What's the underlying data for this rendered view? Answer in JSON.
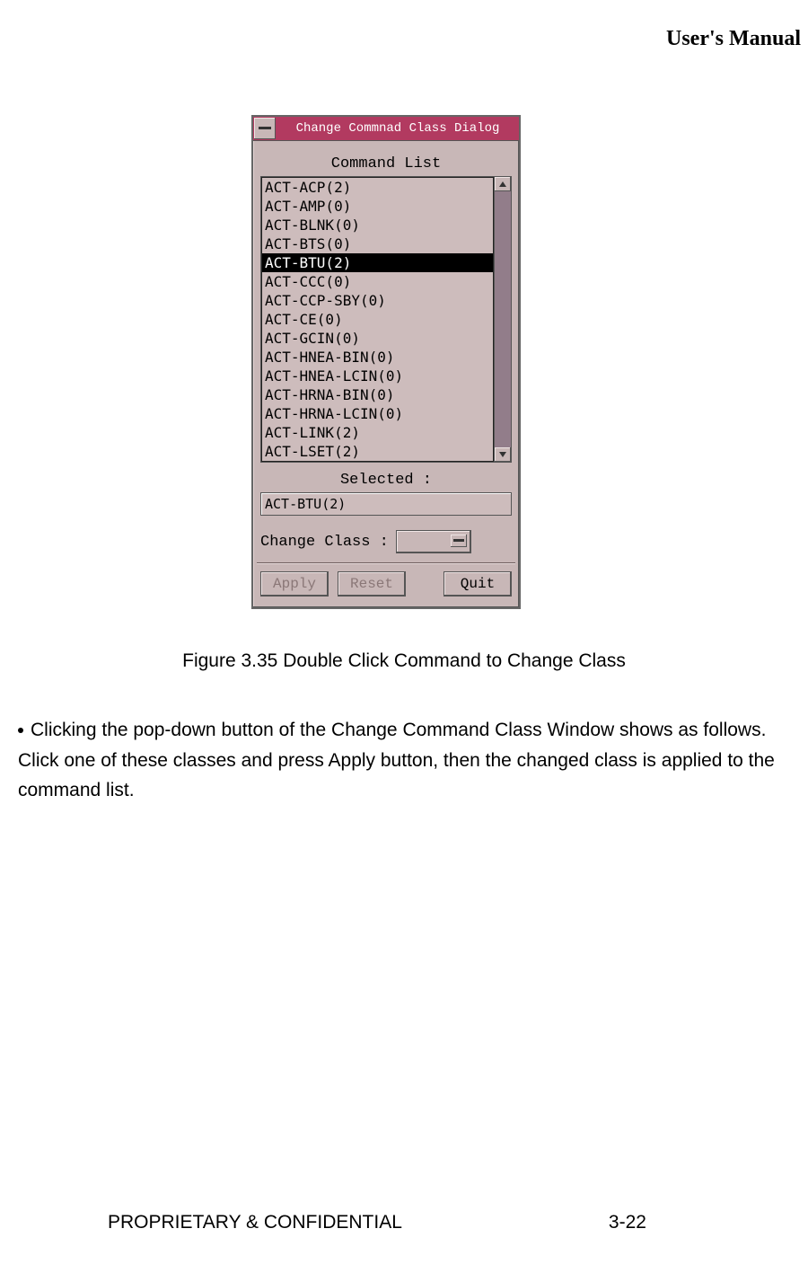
{
  "header": {
    "running": "User's Manual"
  },
  "dialog": {
    "title": "Change Commnad Class Dialog",
    "list_label": "Command List",
    "items": [
      {
        "label": "ACT-ACP(2)",
        "selected": false
      },
      {
        "label": "ACT-AMP(0)",
        "selected": false
      },
      {
        "label": "ACT-BLNK(0)",
        "selected": false
      },
      {
        "label": "ACT-BTS(0)",
        "selected": false
      },
      {
        "label": "ACT-BTU(2)",
        "selected": true
      },
      {
        "label": "ACT-CCC(0)",
        "selected": false
      },
      {
        "label": "ACT-CCP-SBY(0)",
        "selected": false
      },
      {
        "label": "ACT-CE(0)",
        "selected": false
      },
      {
        "label": "ACT-GCIN(0)",
        "selected": false
      },
      {
        "label": "ACT-HNEA-BIN(0)",
        "selected": false
      },
      {
        "label": "ACT-HNEA-LCIN(0)",
        "selected": false
      },
      {
        "label": "ACT-HRNA-BIN(0)",
        "selected": false
      },
      {
        "label": "ACT-HRNA-LCIN(0)",
        "selected": false
      },
      {
        "label": "ACT-LINK(2)",
        "selected": false
      },
      {
        "label": "ACT-LSET(2)",
        "selected": false
      }
    ],
    "selected_label": "Selected :",
    "selected_value": "ACT-BTU(2)",
    "change_class_label": "Change Class :",
    "buttons": {
      "apply": "Apply",
      "reset": "Reset",
      "quit": "Quit"
    }
  },
  "figure_caption": "Figure 3.35 Double Click Command to Change Class",
  "body": {
    "text": "Clicking the pop-down button of the Change Command Class Window shows as follows. Click one of these classes and press Apply button, then the changed class is applied to the command list."
  },
  "footer": {
    "left": "PROPRIETARY & CONFIDENTIAL",
    "right": "3-22"
  }
}
